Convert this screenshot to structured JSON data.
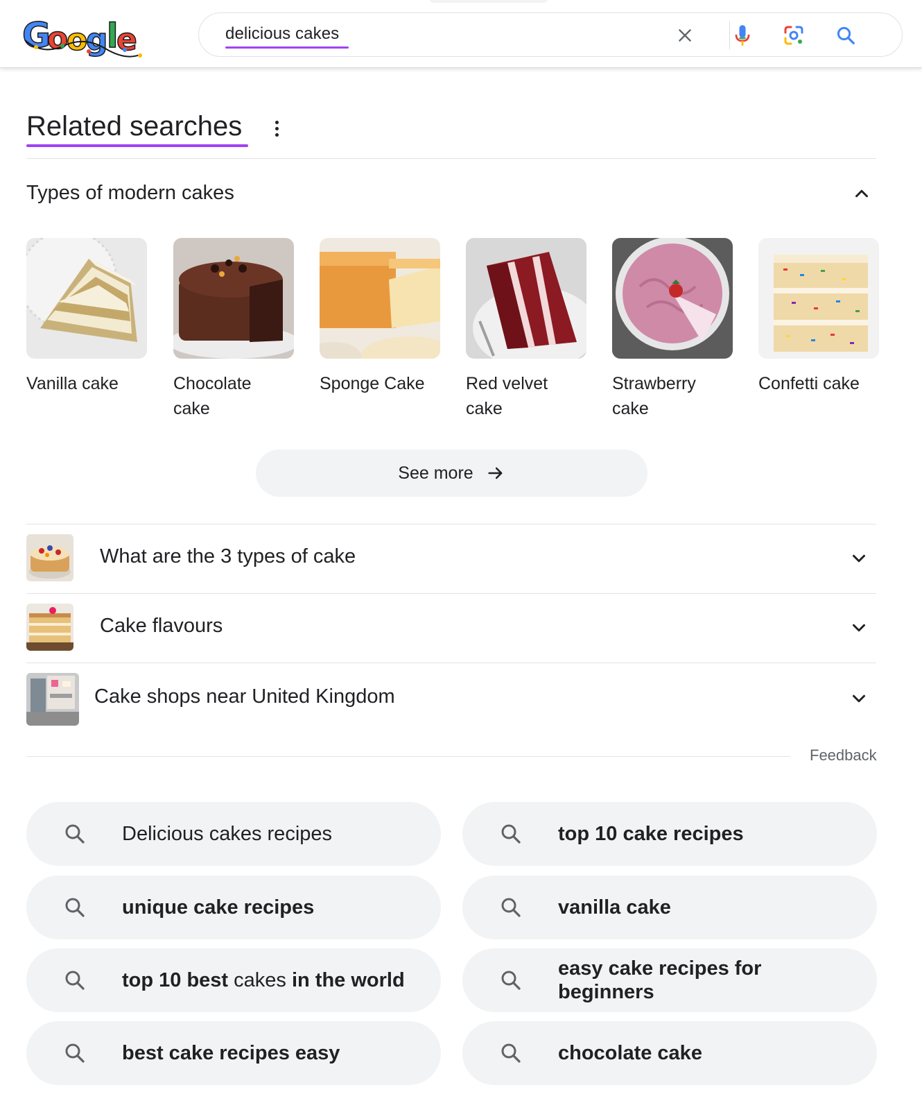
{
  "header": {
    "logo_alt": "Google",
    "search_value": "delicious cakes",
    "icons": [
      "clear-icon",
      "mic-icon",
      "lens-icon",
      "search-icon"
    ]
  },
  "related": {
    "title": "Related searches",
    "section": {
      "title": "Types of modern cakes",
      "cakes": [
        {
          "line1": "Vanilla cake",
          "line2": ""
        },
        {
          "line1": "Chocolate",
          "line2": "cake"
        },
        {
          "line1": "Sponge Cake",
          "line2": ""
        },
        {
          "line1": "Red velvet",
          "line2": "cake"
        },
        {
          "line1": "Strawberry",
          "line2": "cake"
        },
        {
          "line1": "Confetti cake",
          "line2": ""
        }
      ],
      "see_more": "See more"
    },
    "expandables": [
      {
        "label": "What are the 3 types of cake"
      },
      {
        "label": "Cake flavours"
      },
      {
        "label": "Cake shops near United Kingdom"
      }
    ],
    "feedback": "Feedback"
  },
  "chips": [
    {
      "parts": [
        {
          "t": "Delicious cakes recipes",
          "b": false
        }
      ]
    },
    {
      "parts": [
        {
          "t": "top 10 cake recipes",
          "b": true
        }
      ]
    },
    {
      "parts": [
        {
          "t": "unique cake recipes",
          "b": true
        }
      ]
    },
    {
      "parts": [
        {
          "t": "vanilla cake",
          "b": true
        }
      ]
    },
    {
      "parts": [
        {
          "t": "top 10 best",
          "b": true
        },
        {
          "t": " cakes ",
          "b": false
        },
        {
          "t": "in the world",
          "b": true
        }
      ]
    },
    {
      "parts": [
        {
          "t": "easy cake recipes for beginners",
          "b": true
        }
      ]
    },
    {
      "parts": [
        {
          "t": "best cake recipes easy",
          "b": true
        }
      ]
    },
    {
      "parts": [
        {
          "t": "chocolate cake",
          "b": true
        }
      ]
    }
  ],
  "colors": {
    "accent_underline": "#a142f4",
    "chip_bg": "#f1f3f4",
    "text": "#202124",
    "muted": "#5f6368"
  }
}
